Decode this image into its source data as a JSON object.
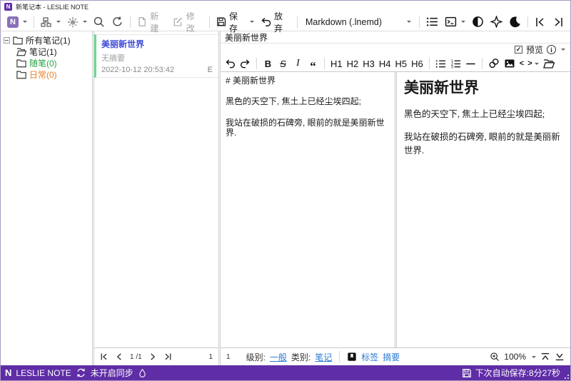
{
  "brand": {
    "logo_letter": "N"
  },
  "titlebar": {
    "title": "新笔记本 - LESLIE NOTE"
  },
  "toolbar": {
    "new_label": "新建",
    "modify_label": "修改",
    "save_label": "保存",
    "discard_label": "放弃",
    "format_selector": "Markdown  (.lnemd)"
  },
  "sidebar": {
    "items": [
      {
        "label": "所有笔记(1)",
        "color": "#1d1d1d"
      },
      {
        "label": "笔记(1)",
        "color": "#1d1d1d"
      },
      {
        "label": "随笔(0)",
        "color": "#26a146"
      },
      {
        "label": "日常(0)",
        "color": "#e6802b"
      }
    ]
  },
  "note_list": {
    "card": {
      "title": "美丽新世界",
      "summary": "无摘要",
      "datetime": "2022-10-12 20:53:42",
      "state_badge": "E"
    },
    "pagination": {
      "page": "1",
      "of": "/1",
      "total_count": "1"
    }
  },
  "editor": {
    "title": "美丽新世界",
    "preview_toggle_label": "预览",
    "md_toolbar": {
      "bold": "B",
      "strike": "S",
      "italic": "I",
      "quote": "“",
      "headings": [
        "H1",
        "H2",
        "H3",
        "H4",
        "H5",
        "H6"
      ],
      "code": "< >"
    },
    "source_text": "# 美丽新世界\n\n黑色的天空下, 焦土上已经尘埃四起;\n\n我站在破损的石碑旁, 眼前的就是美丽新世界.",
    "preview": {
      "heading": "美丽新世界",
      "paragraphs": [
        "黑色的天空下, 焦土上已经尘埃四起;",
        "我站在破损的石碑旁, 眼前的就是美丽新世界."
      ]
    },
    "footer": {
      "line_count": "1",
      "level_label": "级别:",
      "level_value": "一般",
      "category_label": "类别:",
      "category_value": "笔记",
      "tags_label": "标签",
      "summary_label": "摘要",
      "zoom_level": "100%"
    }
  },
  "statusbar": {
    "app_name": "LESLIE NOTE",
    "sync_status": "未开启同步",
    "autosave": "下次自动保存:8分27秒"
  },
  "colors": {
    "accent_purple": "#5f2da6",
    "note_title_blue": "#3d4ad6",
    "link_blue": "#2b7cd3",
    "category_green": "#26a146",
    "category_orange": "#e6802b",
    "card_stripe_green": "#6bd98f"
  },
  "icons": {
    "app_logo": "N-square",
    "search": "magnifier",
    "refresh": "circular-arrow",
    "new_note": "blank-page",
    "modify": "page-pencil",
    "save": "floppy-disk",
    "discard": "undo-arrow",
    "outline": "bulleted-list",
    "terminal": "console-box",
    "theme_contrast": "half-circle",
    "pin": "four-point-star",
    "dark_mode": "moon",
    "collapse_left": "bar-chevron-left",
    "collapse_right": "bar-chevron-right",
    "sync": "two-arrows-circle",
    "ink": "droplet",
    "bookmark": "flag-square",
    "zoom_in": "magnifier-plus",
    "scroll_top": "chevron-up-bar",
    "scroll_bottom": "chevron-down-bar"
  }
}
